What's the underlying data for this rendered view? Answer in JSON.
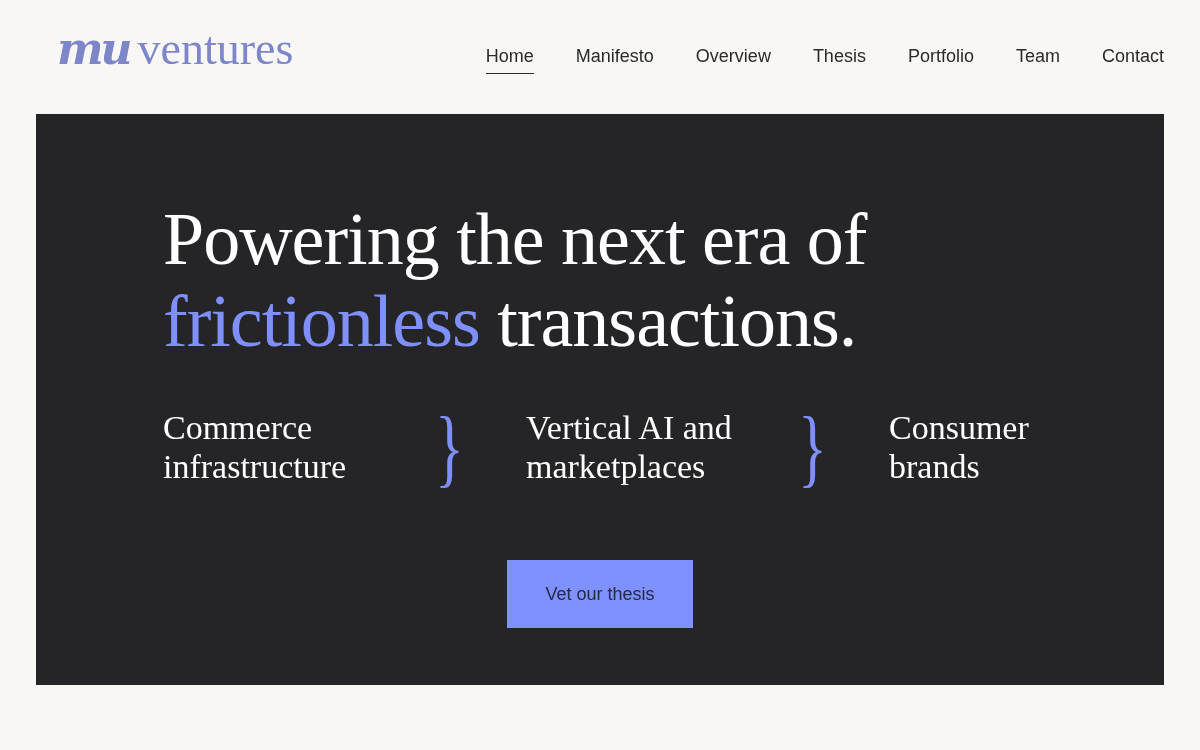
{
  "logo": {
    "mark": "mu",
    "name": "ventures"
  },
  "nav": [
    {
      "label": "Home",
      "selected": true
    },
    {
      "label": "Manifesto",
      "selected": false
    },
    {
      "label": "Overview",
      "selected": false
    },
    {
      "label": "Thesis",
      "selected": false
    },
    {
      "label": "Portfolio",
      "selected": false
    },
    {
      "label": "Team",
      "selected": false
    },
    {
      "label": "Contact",
      "selected": false
    }
  ],
  "hero": {
    "headline": [
      {
        "text": "Powering the next era of",
        "accent": false
      },
      {
        "text": "frictionless",
        "accent": true
      },
      {
        "text": "transactions.",
        "accent": false
      }
    ],
    "focus_areas": [
      {
        "kind": "area",
        "lines": [
          "Commerce",
          "infrastructure"
        ]
      },
      {
        "kind": "brace",
        "lines": [
          "}"
        ]
      },
      {
        "kind": "area",
        "lines": [
          "Vertical AI and",
          "marketplaces"
        ]
      },
      {
        "kind": "brace",
        "lines": [
          "}"
        ]
      },
      {
        "kind": "area",
        "lines": [
          "Consumer",
          "brands"
        ]
      }
    ],
    "cta": "Vet our thesis"
  }
}
